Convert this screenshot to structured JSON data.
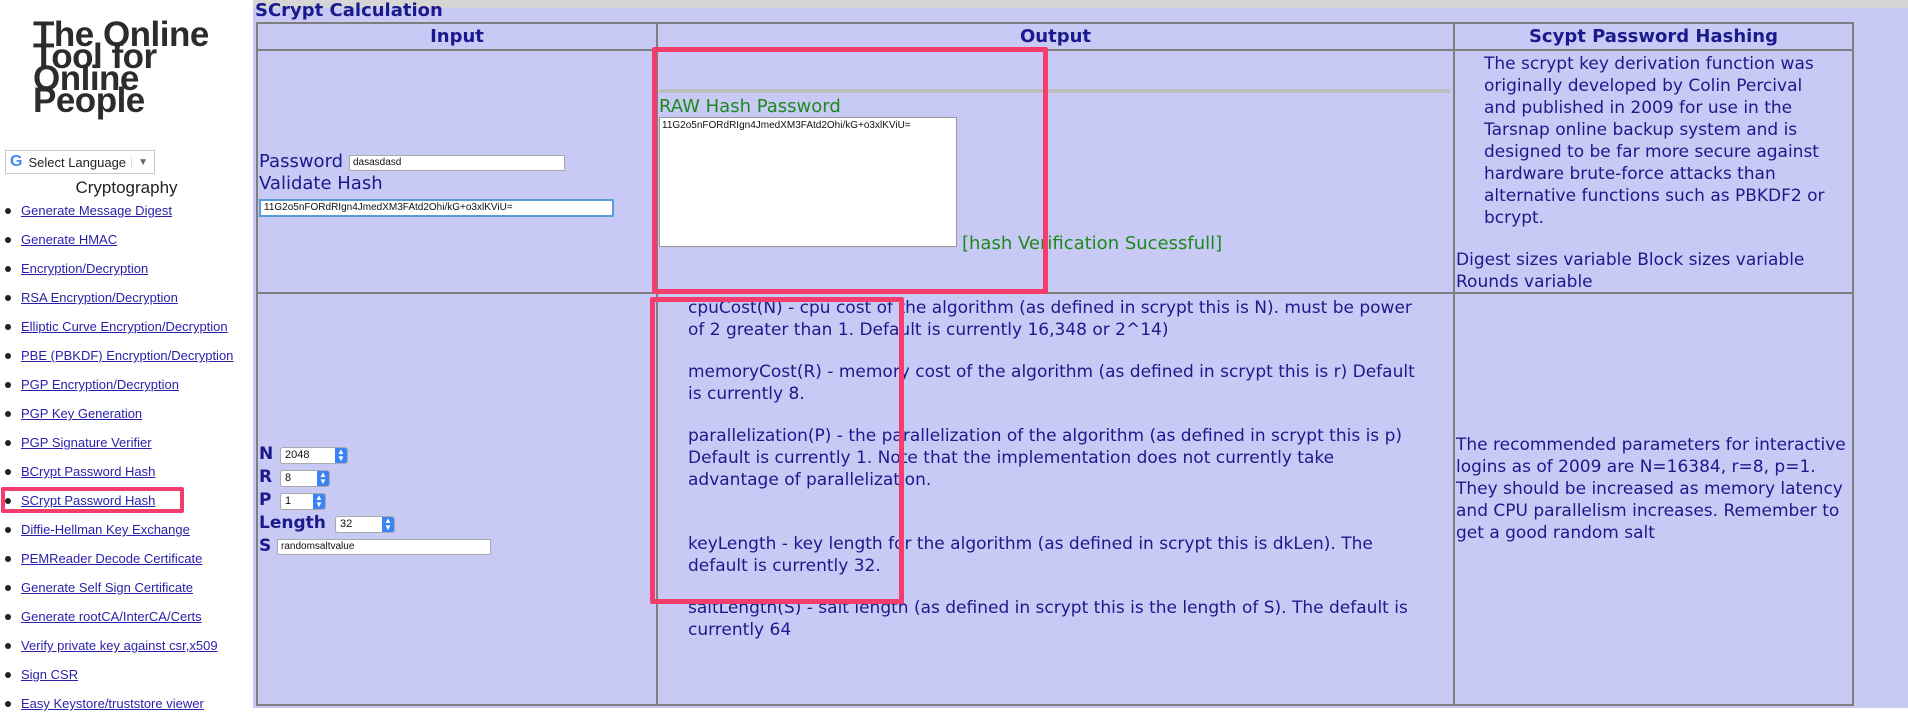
{
  "sidebar": {
    "logo_lines": [
      "The Online",
      "Tool for",
      "Online",
      "People"
    ],
    "language_label": "Select Language",
    "section_title": "Cryptography",
    "items": [
      {
        "label": "Generate Message Digest"
      },
      {
        "label": "Generate HMAC"
      },
      {
        "label": "Encryption/Decryption"
      },
      {
        "label": "RSA Encryption/Decryption"
      },
      {
        "label": "Elliptic Curve Encryption/Decryption"
      },
      {
        "label": "PBE (PBKDF) Encryption/Decryption"
      },
      {
        "label": "PGP Encryption/Decryption"
      },
      {
        "label": "PGP Key Generation"
      },
      {
        "label": "PGP Signature Verifier"
      },
      {
        "label": "BCrypt Password Hash"
      },
      {
        "label": "SCrypt Password Hash"
      },
      {
        "label": "Diffie-Hellman Key Exchange"
      },
      {
        "label": "PEMReader Decode Certificate"
      },
      {
        "label": "Generate Self Sign Certificate"
      },
      {
        "label": "Generate rootCA/InterCA/Certs"
      },
      {
        "label": "Verify private key against csr,x509"
      },
      {
        "label": "Sign CSR"
      },
      {
        "label": "Easy Keystore/truststore viewer"
      }
    ]
  },
  "main": {
    "title": "SCrypt Calculation",
    "headers": {
      "input": "Input",
      "output": "Output",
      "info": "Scypt Password Hashing"
    },
    "input": {
      "password_label": "Password",
      "password_value": "dasasdasd",
      "validate_label": "Validate Hash",
      "validate_value": "11G2o5nFORdRIgn4JmedXM3FAtd2Ohi/kG+o3xlKViU=",
      "n_label": "N",
      "n_value": "2048",
      "r_label": "R",
      "r_value": "8",
      "p_label": "P",
      "p_value": "1",
      "length_label": "Length",
      "length_value": "32",
      "s_label": "S",
      "s_value": "randomsaltvalue"
    },
    "output": {
      "raw_label": "RAW Hash Password",
      "raw_value": "11G2o5nFORdRIgn4JmedXM3FAtd2Ohi/kG+o3xlKViU=",
      "verification": "[hash Verification Sucessfull]"
    },
    "info": {
      "description": "The scrypt key derivation function was originally developed by Colin Percival and published in 2009 for use in the Tarsnap online backup system and is designed to be far more secure against hardware brute-force attacks than alternative functions such as PBKDF2 or bcrypt.",
      "sizes": "Digest sizes variable Block sizes variable Rounds variable",
      "recommend": "The recommended parameters for interactive logins as of 2009 are N=16384, r=8, p=1. They should be increased as memory latency and CPU parallelism increases. Remember to get a good random salt"
    },
    "params": {
      "cpu": "cpuCost(N) - cpu cost of the algorithm (as defined in scrypt this is N). must be power of 2 greater than 1. Default is currently 16,348 or 2^14)",
      "memory": "memoryCost(R) - memory cost of the algorithm (as defined in scrypt this is r) Default is currently 8.",
      "parallel": "parallelization(P) - the parallelization of the algorithm (as defined in scrypt this is p) Default is currently 1. Note that the implementation does not currently take advantage of parallelization.",
      "keylength": "keyLength - key length for the algorithm (as defined in scrypt this is dkLen). The default is currently 32.",
      "saltlength": "saltLength(S) - salt length (as defined in scrypt this is the length of S). The default is currently 64"
    }
  },
  "colors": {
    "highlight": "#f23d6d",
    "panel": "#c9c9f5",
    "link": "#2a1fa8",
    "heading": "#1a1a8c",
    "success": "#1b8a1b"
  }
}
